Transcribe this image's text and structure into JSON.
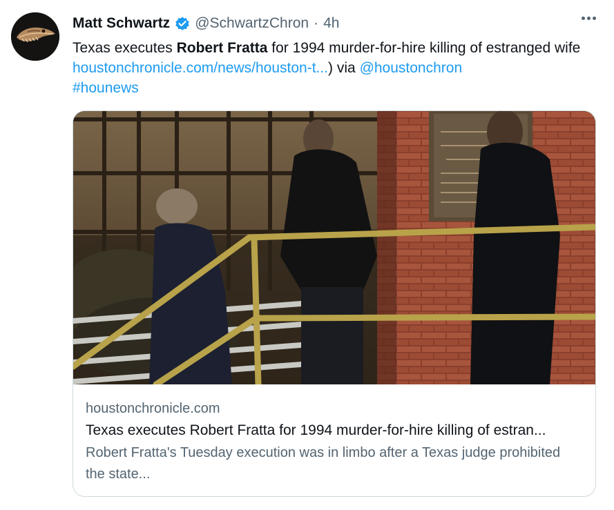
{
  "tweet": {
    "display_name": "Matt Schwartz",
    "handle": "@SchwartzChron",
    "separator": "·",
    "time": "4h",
    "text_part1": "Texas executes ",
    "text_bold": "Robert Fratta",
    "text_part2": " for 1994 murder-for-hire killing of estranged wife ",
    "link_url": "houstonchronicle.com/news/houston-t...",
    "text_part3": ") via ",
    "mention": "@houstonchron",
    "hashtag": "#hounews"
  },
  "card": {
    "domain": "houstonchronicle.com",
    "title": "Texas executes Robert Fratta for 1994 murder-for-hire killing of estran...",
    "description": "Robert Fratta's Tuesday execution was in limbo after a Texas judge prohibited the state..."
  },
  "colors": {
    "link": "#1d9bf0",
    "verified": "#1d9bf0",
    "secondary_text": "#536471",
    "border": "#cfd9de"
  },
  "icons": {
    "verified": "verified-badge-icon",
    "more": "more-icon"
  }
}
